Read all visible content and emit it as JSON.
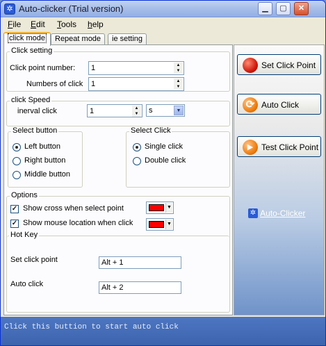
{
  "window": {
    "title": "Auto-clicker (Trial version)",
    "icon": "gear-icon",
    "controls": [
      "minimize-icon",
      "maximize-icon",
      "close-icon"
    ]
  },
  "menu": [
    {
      "label": "File",
      "hotkey": "F"
    },
    {
      "label": "Edit",
      "hotkey": "E"
    },
    {
      "label": "Tools",
      "hotkey": "T"
    },
    {
      "label": "help",
      "hotkey": "h"
    }
  ],
  "tabs": [
    {
      "label": "click mode",
      "active": true
    },
    {
      "label": "Repeat mode",
      "active": false
    },
    {
      "label": "ie setting",
      "active": false
    }
  ],
  "click_setting": {
    "title": "Click setting",
    "point_number_label": "Click point number:",
    "point_number_value": "1",
    "numbers_label": "Numbers of click",
    "numbers_value": "1"
  },
  "click_speed": {
    "title": "click Speed",
    "interval_label": "inerval click",
    "interval_value": "1",
    "unit_value": "s"
  },
  "select_button": {
    "title": "Select button",
    "options": [
      "Left button",
      "Right button",
      "Middle button"
    ],
    "selected": 0
  },
  "select_click": {
    "title": "Select Click",
    "options": [
      "Single click",
      "Double click"
    ],
    "selected": 0
  },
  "options": {
    "title": "Options",
    "show_cross_label": "Show cross when select point",
    "show_cross_checked": true,
    "show_cross_color": "#ff0000",
    "show_mouse_label": "Show mouse location when click",
    "show_mouse_checked": true,
    "show_mouse_color": "#ff0000"
  },
  "hotkey": {
    "title": "Hot Key",
    "set_point_label": "Set click point",
    "set_point_value": "Alt + 1",
    "auto_click_label": "Auto click",
    "auto_click_value": "Alt + 2"
  },
  "actions": {
    "set_click_point": "Set Click Point",
    "auto_click": "Auto Click",
    "test_click_point": "Test Click Point",
    "link_label": "Auto-Clicker"
  },
  "status": {
    "text": "Click this buttion to start auto click"
  },
  "colors": {
    "title_bar": "#a8bfe9",
    "window_bg": "#ece9d8",
    "status_bg": "#4d76c2",
    "accent_red": "#ff0000"
  }
}
